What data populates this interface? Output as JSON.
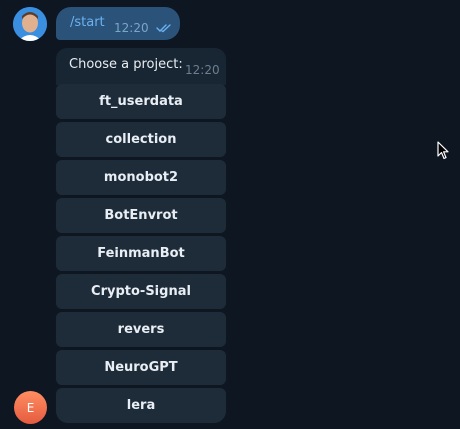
{
  "outgoing_message": {
    "text": "/start",
    "time": "12:20",
    "status_icon": "double-check-icon"
  },
  "incoming_message": {
    "text": "Choose a project:",
    "time": "12:20"
  },
  "keyboard": {
    "buttons": [
      "ft_userdata",
      "collection",
      "monobot2",
      "BotEnvrot",
      "FeinmanBot",
      "Crypto-Signal",
      "revers",
      "NeuroGPT",
      "lera"
    ]
  },
  "bot_avatar": {
    "initial": "E"
  },
  "colors": {
    "background": "#0e1621",
    "outgoing_bubble": "#2b5278",
    "incoming_bubble": "#182533",
    "keyboard_button": "#1e2c3a",
    "link_blue": "#6ab2f2",
    "bot_avatar": "#e55b3f"
  }
}
